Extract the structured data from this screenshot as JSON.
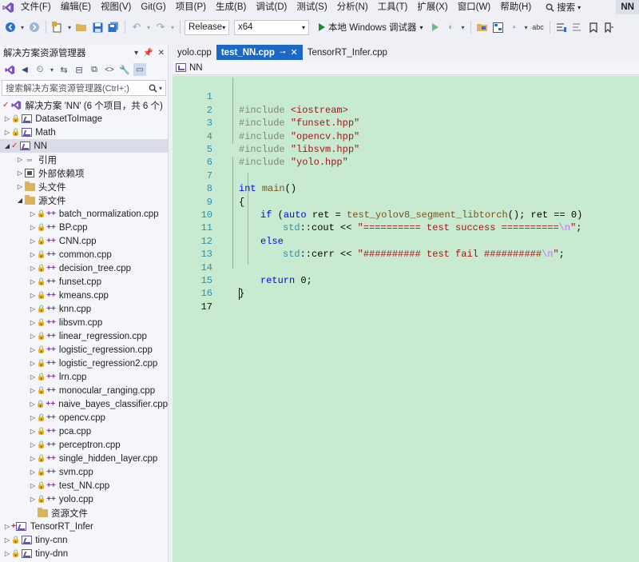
{
  "menu": {
    "items": [
      "文件(F)",
      "编辑(E)",
      "视图(V)",
      "Git(G)",
      "项目(P)",
      "生成(B)",
      "调试(D)",
      "测试(S)",
      "分析(N)",
      "工具(T)",
      "扩展(X)",
      "窗口(W)",
      "帮助(H)"
    ],
    "search_label": "搜索",
    "project_badge": "NN"
  },
  "toolbar": {
    "configuration": "Release",
    "platform": "x64",
    "run_label": "本地 Windows 调试器"
  },
  "solution_explorer": {
    "title": "解决方案资源管理器",
    "search_placeholder": "搜索解决方案资源管理器(Ctrl+;)",
    "solution_label": "解决方案 'NN' (6 个项目，共 6 个)",
    "projects_top": [
      "DatasetToImage",
      "Math"
    ],
    "active_project": "NN",
    "nn_children": [
      "引用",
      "外部依赖项",
      "头文件",
      "源文件"
    ],
    "source_files": [
      "batch_normalization.cpp",
      "BP.cpp",
      "CNN.cpp",
      "common.cpp",
      "decision_tree.cpp",
      "funset.cpp",
      "kmeans.cpp",
      "knn.cpp",
      "libsvm.cpp",
      "linear_regression.cpp",
      "logistic_regression.cpp",
      "logistic_regression2.cpp",
      "lrn.cpp",
      "monocular_ranging.cpp",
      "naive_bayes_classifier.cpp",
      "opencv.cpp",
      "pca.cpp",
      "perceptron.cpp",
      "single_hidden_layer.cpp",
      "svm.cpp",
      "test_NN.cpp",
      "yolo.cpp"
    ],
    "resource_folder": "资源文件",
    "projects_bottom": [
      "TensorRT_Infer",
      "tiny-cnn",
      "tiny-dnn"
    ]
  },
  "tabs": [
    {
      "label": "yolo.cpp",
      "active": false
    },
    {
      "label": "test_NN.cpp",
      "active": true
    },
    {
      "label": "TensorRT_Infer.cpp",
      "active": false
    }
  ],
  "navbar": {
    "scope": "NN"
  },
  "editor": {
    "line_numbers": [
      "1",
      "2",
      "3",
      "4",
      "5",
      "6",
      "7",
      "8",
      "9",
      "10",
      "11",
      "12",
      "13",
      "14",
      "15",
      "16",
      "17"
    ],
    "current_line": "17",
    "code": {
      "l1_directive": "#include",
      "l1_header": "<iostream>",
      "l2_directive": "#include",
      "l2_header": "\"funset.hpp\"",
      "l3_directive": "#include",
      "l3_header": "\"opencv.hpp\"",
      "l4_directive": "#include",
      "l4_header": "\"libsvm.hpp\"",
      "l5_directive": "#include",
      "l5_header": "\"yolo.hpp\"",
      "l7_type": "int",
      "l7_name": "main",
      "l7_rest": "()",
      "l8": "{",
      "l9_if": "if",
      "l9_open": " (",
      "l9_auto": "auto",
      "l9_mid": " ret = ",
      "l9_fn": "test_yolov8_segment_libtorch",
      "l9_call": "(); ",
      "l9_ret": "ret",
      "l9_end": " == 0)",
      "l10_ns": "std",
      "l10_sep": "::cout << ",
      "l10_str": "\"========== test success ==========",
      "l10_esc": "\\n",
      "l10_close": "\"",
      "l10_semi": ";",
      "l11_else": "else",
      "l12_ns": "std",
      "l12_sep": "::cerr << ",
      "l12_str": "\"########## test fail ##########",
      "l12_esc": "\\n",
      "l12_close": "\"",
      "l12_semi": ";",
      "l14_return": "return",
      "l14_rest": " 0;",
      "l15": "}"
    }
  },
  "colors": {
    "accent": "#1c68c4",
    "editor_bg": "#c8ead0",
    "keyword": "#0000ff",
    "string": "#a31515",
    "line_number": "#2b91af"
  }
}
